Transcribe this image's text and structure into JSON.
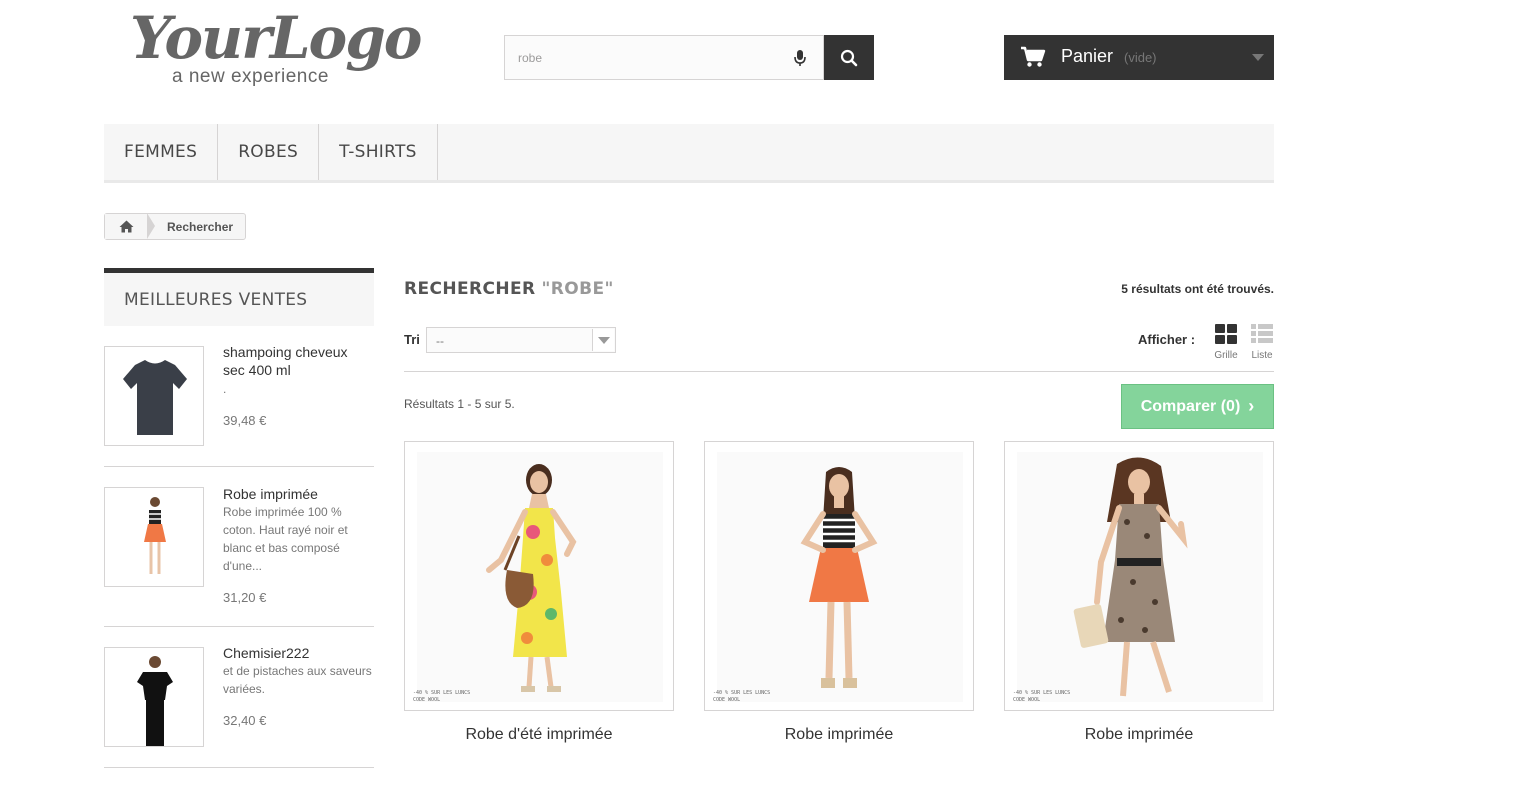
{
  "header": {
    "logo_text": "YourLogo",
    "logo_tagline": "a new experience",
    "search_value": "robe",
    "cart_label": "Panier",
    "cart_status": "(vide)"
  },
  "menu": {
    "items": [
      "FEMMES",
      "ROBES",
      "T-SHIRTS"
    ]
  },
  "breadcrumb": {
    "current": "Rechercher"
  },
  "sidebar": {
    "title": "MEILLEURES VENTES",
    "items": [
      {
        "name": "shampoing cheveux sec 400 ml",
        "desc": ".",
        "price": "39,48 €"
      },
      {
        "name": "Robe imprimée",
        "desc": "Robe imprimée 100 % coton. Haut rayé noir et blanc et bas composé d'une...",
        "price": "31,20 €"
      },
      {
        "name": "Chemisier222",
        "desc": "et de pistaches aux saveurs variées.",
        "price": "32,40 €"
      }
    ]
  },
  "main": {
    "title": "RECHERCHER",
    "query": "\"ROBE\"",
    "results_found": "5 résultats ont été trouvés.",
    "sort_label": "Tri",
    "sort_value": "--",
    "view_label": "Afficher :",
    "view_grid": "Grille",
    "view_list": "Liste",
    "pager": "Résultats 1 - 5 sur 5.",
    "compare": "Comparer (0)",
    "products": [
      {
        "name": "Robe d'été imprimée",
        "brand_line1": "-40 % SUR LES LUNCS",
        "brand_line2": "CODE WOOL"
      },
      {
        "name": "Robe imprimée",
        "brand_line1": "-40 % SUR LES LUNCS",
        "brand_line2": "CODE WOOL"
      },
      {
        "name": "Robe imprimée",
        "brand_line1": "-40 % SUR LES LUNCS",
        "brand_line2": "CODE WOOL"
      }
    ]
  }
}
